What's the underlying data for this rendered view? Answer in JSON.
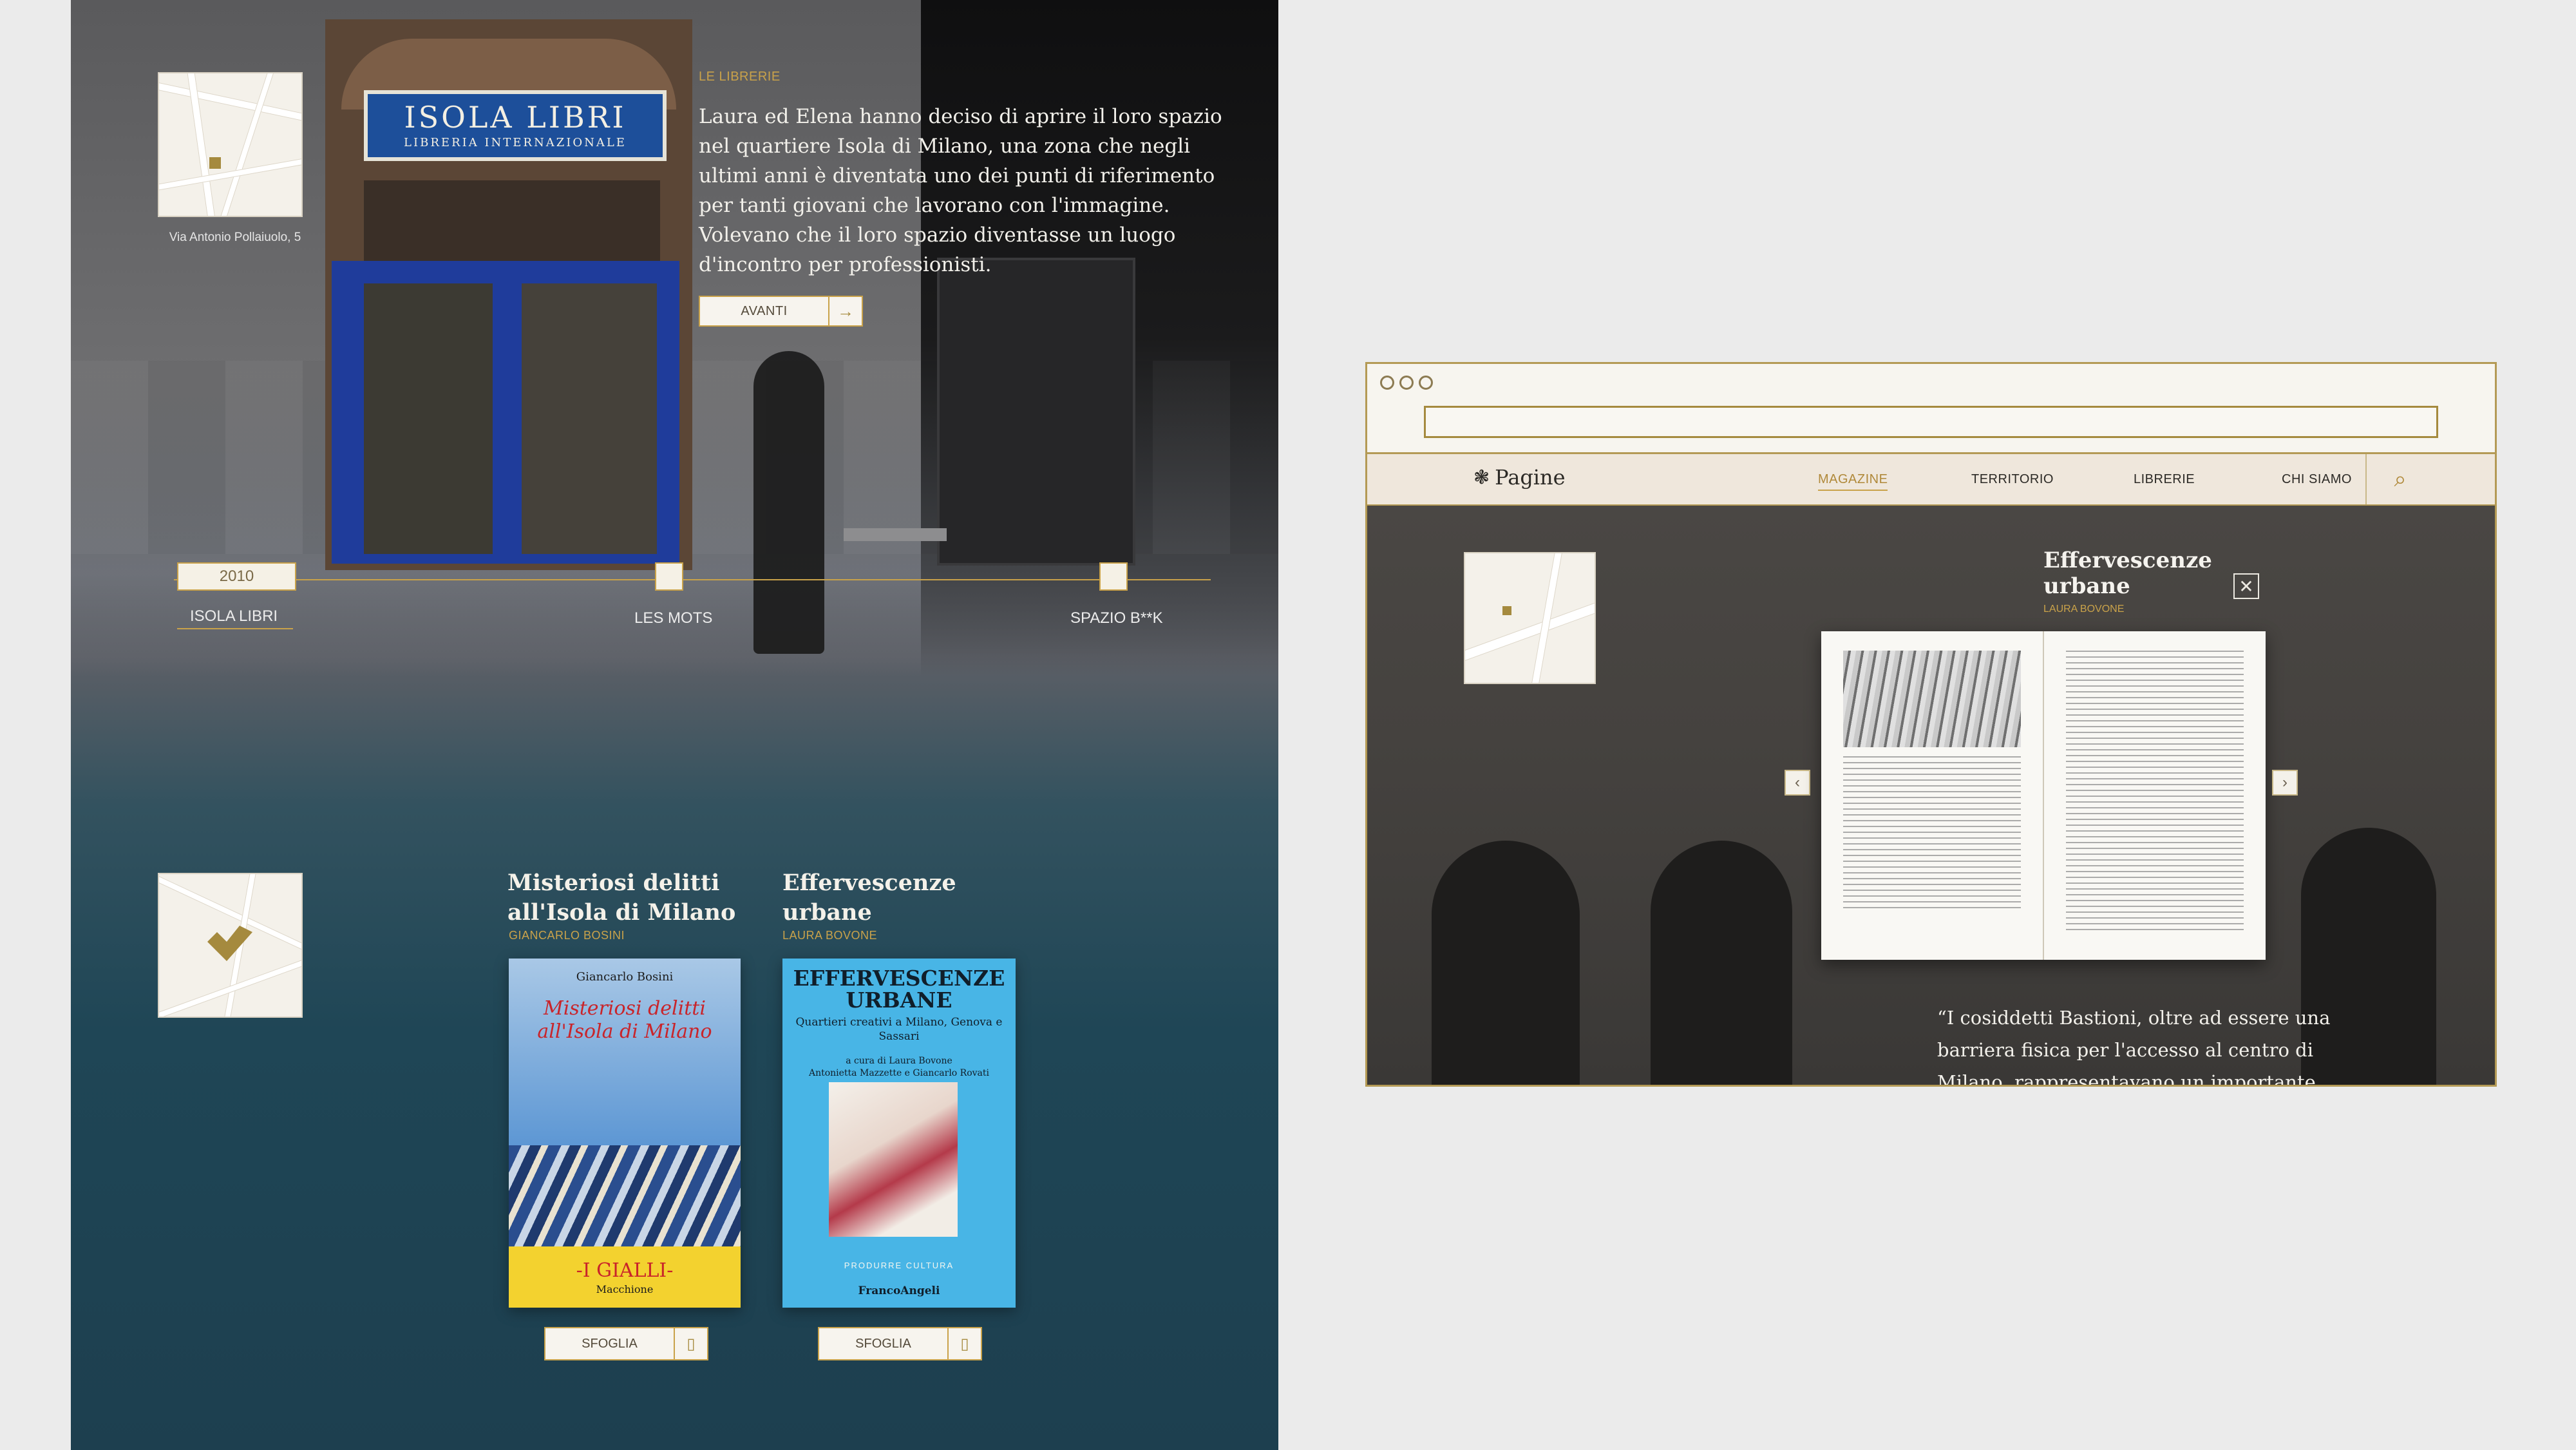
{
  "left": {
    "shop_sign": {
      "title": "ISOLA LIBRI",
      "subtitle": "LIBRERIA INTERNAZIONALE"
    },
    "map_caption": "Via Antonio Pollaiuolo, 5",
    "section_kicker": "LE LIBRERIE",
    "section_body": "Laura ed Elena hanno deciso di aprire il loro spazio nel quartiere Isola di Milano, una zona che negli ultimi anni è diventata uno dei punti di riferimento per tanti giovani che lavorano con l'immagine. Volevano che il loro spazio diventasse un luogo d'incontro per professionisti.",
    "next_button": {
      "label": "AVANTI",
      "icon": "arrow-right-icon"
    },
    "timeline": {
      "year": "2010",
      "stops": [
        "ISOLA LIBRI",
        "LES MOTS",
        "SPAZIO B**K"
      ]
    },
    "books": [
      {
        "title": "Misteriosi delitti all'Isola di Milano",
        "author": "GIANCARLO BOSINI",
        "cover": {
          "author": "Giancarlo Bosini",
          "title": "Misteriosi delitti all'Isola di Milano",
          "series": "-I GIALLI-",
          "publisher": "Macchione"
        },
        "button": "SFOGLIA"
      },
      {
        "title": "Effervescenze urbane",
        "author": "LAURA BOVONE",
        "cover": {
          "title": "EFFERVESCENZE URBANE",
          "subtitle": "Quartieri creativi a Milano, Genova e Sassari",
          "curators": "a cura di Laura Bovone\nAntonietta Mazzette e Giancarlo Rovati",
          "series": "PRODURRE CULTURA",
          "publisher": "FrancoAngeli"
        },
        "button": "SFOGLIA"
      }
    ]
  },
  "browser": {
    "logo": "Pagine",
    "nav": [
      "MAGAZINE",
      "TERRITORIO",
      "LIBRERIE",
      "CHI SIAMO"
    ],
    "search_icon": "search-icon",
    "article_title": "Effervescenze urbane",
    "article_author": "LAURA BOVONE",
    "quote": "“I cosiddetti Bastioni, oltre ad essere una barriera fisica per l'accesso al centro di Milano, rappresentavano un importante confine"
  },
  "colors": {
    "gold": "#c9a24a",
    "teal": "#1d3f4f",
    "cream": "#f7f4ee"
  }
}
